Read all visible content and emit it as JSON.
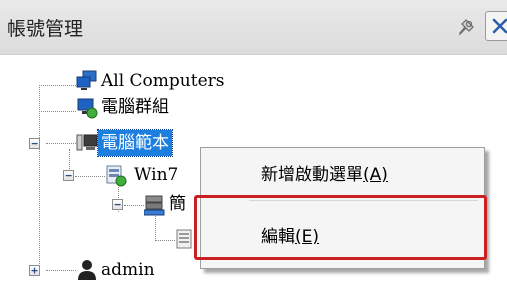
{
  "window": {
    "title": "帳號管理",
    "pin_icon": "pin-icon",
    "close_icon": "close-icon"
  },
  "tree": {
    "items": [
      {
        "label": "All Computers",
        "icon": "monitor-network-icon"
      },
      {
        "label": "電腦群組",
        "icon": "monitor-group-icon"
      },
      {
        "label": "電腦範本",
        "icon": "computer-template-icon",
        "selected": true,
        "expander": "−"
      },
      {
        "label": "Win7",
        "icon": "disk-image-icon",
        "expander": "−"
      },
      {
        "label": "簡",
        "icon": "server-icon",
        "expander": "−"
      },
      {
        "label": "",
        "icon": "document-icon"
      },
      {
        "label": "admin",
        "icon": "user-icon",
        "expander": "+"
      }
    ]
  },
  "context_menu": {
    "items": [
      {
        "label": "新增啟動選單",
        "accel": "(A)"
      },
      {
        "label": "編輯",
        "accel": "(E)"
      }
    ]
  },
  "colors": {
    "selection": "#1c7fe0",
    "highlight": "#cc1f1f"
  }
}
